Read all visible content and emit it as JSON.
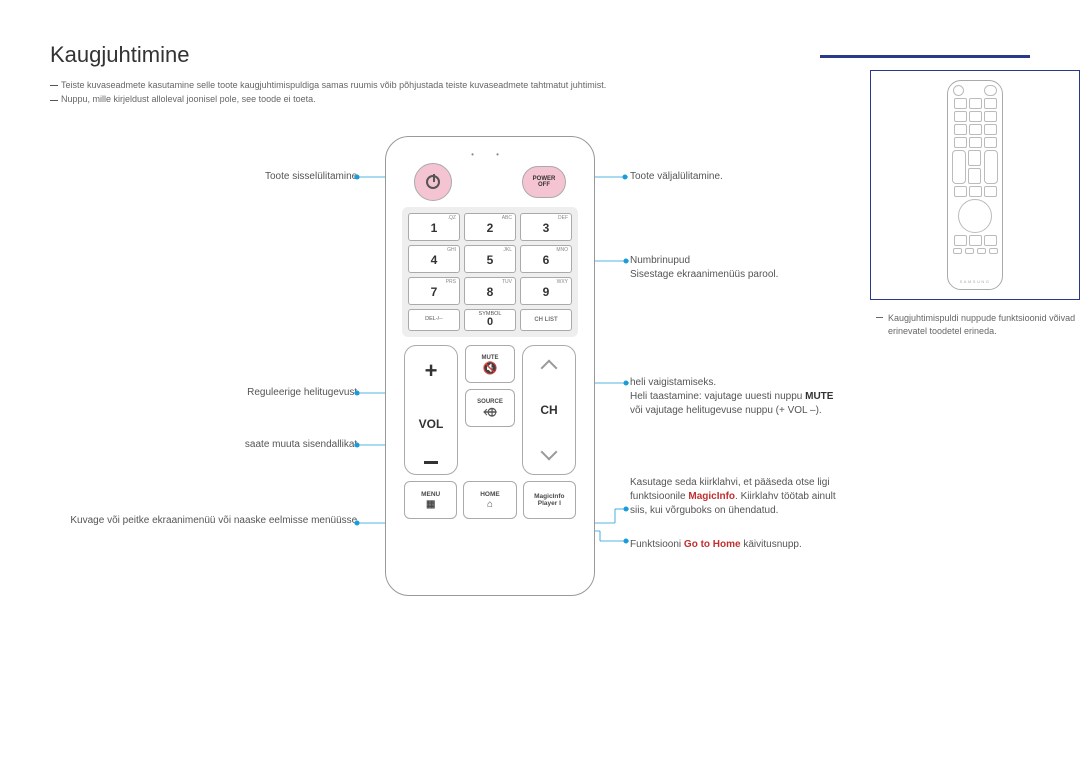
{
  "title": "Kaugjuhtimine",
  "notes": [
    "Teiste kuvaseadmete kasutamine selle toote kaugjuhtimispuldiga samas ruumis võib põhjustada teiste kuvaseadmete tahtmatut juhtimist.",
    "Nuppu, mille kirjeldust alloleval joonisel pole, see toode ei toeta."
  ],
  "sidebar_note": "Kaugjuhtimispuldi nuppude funktsioonid võivad erinevatel toodetel erineda.",
  "remote": {
    "power_off": {
      "l1": "POWER",
      "l2": "OFF"
    },
    "numpad": [
      {
        "n": "1",
        "sub": ".QZ"
      },
      {
        "n": "2",
        "sub": "ABC"
      },
      {
        "n": "3",
        "sub": "DEF"
      },
      {
        "n": "4",
        "sub": "GHI"
      },
      {
        "n": "5",
        "sub": "JKL"
      },
      {
        "n": "6",
        "sub": "MNO"
      },
      {
        "n": "7",
        "sub": "PRS"
      },
      {
        "n": "8",
        "sub": "TUV"
      },
      {
        "n": "9",
        "sub": "WXY"
      }
    ],
    "row4": [
      {
        "l1": "DEL-/--",
        "l2": ""
      },
      {
        "l1": "SYMBOL",
        "l2": "0"
      },
      {
        "l1": "CH LIST",
        "l2": ""
      }
    ],
    "vol_label": "VOL",
    "ch_label": "CH",
    "mid": [
      {
        "t": "MUTE",
        "ic": "🔇"
      },
      {
        "t": "SOURCE",
        "ic": "⬲"
      }
    ],
    "bottom": [
      {
        "t": "MENU",
        "ic": "▦"
      },
      {
        "t": "HOME",
        "ic": "⌂"
      },
      {
        "t": "MagicInfo",
        "t2": "Player I"
      }
    ]
  },
  "callouts": {
    "on": "Toote sisselülitamine.",
    "off": "Toote väljalülitamine.",
    "num1": "Numbrinupud",
    "num2": "Sisestage ekraanimenüüs parool.",
    "vol": "Reguleerige helitugevust.",
    "src": "saate muuta sisendallikat.",
    "menu": "Kuvage või peitke ekraanimenüü või naaske eelmisse menüüsse.",
    "mute1": "heli vaigistamiseks.",
    "mute2a": "Heli taastamine: vajutage uuesti nuppu ",
    "mute2b": "MUTE",
    "mute3": "või vajutage helitugevuse nuppu (+ VOL –).",
    "magic1": "Kasutage seda kiirklahvi, et pääseda otse ligi",
    "magic2a": "funktsioonile ",
    "magic2b": "MagicInfo",
    "magic2c": ". Kiirklahv töötab ainult",
    "magic3": "siis, kui võrguboks on ühendatud.",
    "home1": "Funktsiooni ",
    "home2": "Go to Home",
    "home3": " käivitusnupp."
  }
}
